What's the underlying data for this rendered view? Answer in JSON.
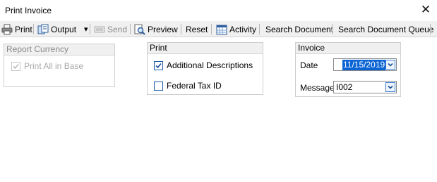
{
  "window": {
    "title": "Print Invoice",
    "close_glyph": "✕"
  },
  "toolbar": {
    "print": "Print",
    "output": "Output",
    "output_arrow": "▾",
    "send": "Send",
    "preview": "Preview",
    "reset": "Reset",
    "activity": "Activity",
    "search_document": "Search Document",
    "search_document_queue": "Search Document Queue"
  },
  "report_currency": {
    "header": "Report Currency",
    "print_all_in_base": {
      "label": "Print All in Base",
      "checked": true,
      "enabled": false
    }
  },
  "print_group": {
    "header": "Print",
    "additional_descriptions": {
      "label": "Additional Descriptions",
      "checked": true
    },
    "federal_tax_id": {
      "label": "Federal Tax ID",
      "checked": false
    }
  },
  "invoice": {
    "header": "Invoice",
    "date_label": "Date",
    "date_value": "11/15/2019",
    "message_label": "Message",
    "message_value": "I002"
  },
  "icons": {
    "print": "printer-icon",
    "output": "output-icon",
    "send": "send-icon",
    "preview": "preview-icon",
    "activity": "calendar-icon",
    "close": "close-icon",
    "dropdown": "chevron-down-icon"
  },
  "colors": {
    "accent": "#0a64d4",
    "checkbox_border": "#1a5aa8",
    "toolbar_bg": "#f0f0f0",
    "disabled_text": "#a9a9a9"
  }
}
